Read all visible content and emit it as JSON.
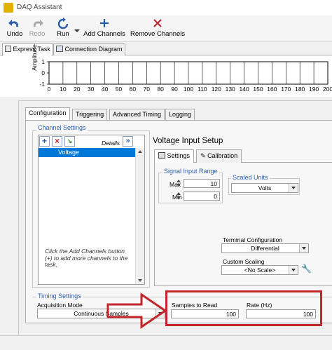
{
  "window": {
    "title": "DAQ Assistant",
    "app_icon": "daq-app-icon"
  },
  "toolbar": {
    "undo": {
      "label": "Undo",
      "icon": "undo-icon",
      "color": "#2b5da8"
    },
    "redo": {
      "label": "Redo",
      "icon": "redo-icon",
      "enabled": false
    },
    "run": {
      "label": "Run",
      "icon": "run-refresh-icon"
    },
    "add_channels": {
      "label": "Add Channels",
      "icon": "plus-icon"
    },
    "remove_channels": {
      "label": "Remove Channels",
      "icon": "x-icon",
      "color": "#c1272d"
    }
  },
  "main_tabs": [
    {
      "label": "Express Task",
      "icon": "express-task-icon",
      "active": true
    },
    {
      "label": "Connection Diagram",
      "icon": "connection-diagram-icon",
      "active": false
    }
  ],
  "graph": {
    "ylabel": "Amplitude",
    "yticks": [
      "1",
      "0",
      "-1"
    ],
    "xticks": [
      "0",
      "10",
      "20",
      "30",
      "40",
      "50",
      "60",
      "70",
      "80",
      "90",
      "100",
      "110",
      "120",
      "130",
      "140",
      "150",
      "160",
      "170",
      "180",
      "190",
      "200"
    ]
  },
  "config_tabs": [
    {
      "label": "Configuration",
      "active": true
    },
    {
      "label": "Triggering",
      "active": false
    },
    {
      "label": "Advanced Timing",
      "active": false
    },
    {
      "label": "Logging",
      "active": false
    }
  ],
  "channel_settings": {
    "title": "Channel Settings",
    "details_label": "Details",
    "channels": [
      "Voltage"
    ],
    "hint": "Click the Add Channels button (+) to add more channels to the task."
  },
  "voltage_setup": {
    "title": "Voltage Input Setup",
    "tabs": [
      {
        "label": "Settings",
        "icon": "settings-icon",
        "active": true
      },
      {
        "label": "Calibration",
        "icon": "calibration-icon",
        "active": false
      }
    ],
    "signal_input_range": {
      "title": "Signal Input Range",
      "max_label": "Max",
      "max_value": "10",
      "min_label": "Min",
      "min_value": "0"
    },
    "scaled_units": {
      "title": "Scaled Units",
      "value": "Volts"
    },
    "terminal_configuration": {
      "label": "Terminal Configuration",
      "value": "Differential"
    },
    "custom_scaling": {
      "label": "Custom Scaling",
      "value": "<No Scale>"
    }
  },
  "timing_settings": {
    "title": "Timing Settings",
    "acquisition_mode_label": "Acquisition Mode",
    "acquisition_mode_value": "Continuous Samples",
    "samples_to_read_label": "Samples to Read",
    "samples_to_read_value": "100",
    "rate_label": "Rate (Hz)",
    "rate_value": "100"
  },
  "annotation": {
    "highlight_color": "#c1272d"
  }
}
